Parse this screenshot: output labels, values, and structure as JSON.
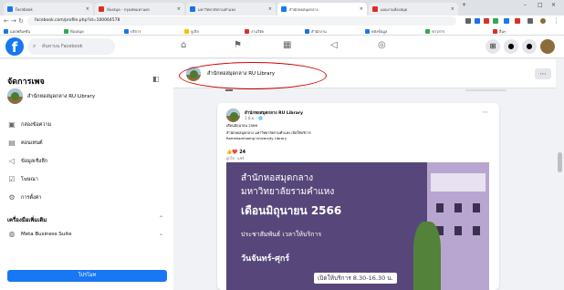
{
  "browser": {
    "tabs": [
      {
        "title": "Facebook",
        "active": false,
        "color": "#1877f2"
      },
      {
        "title": "ห้องสมุด - กรุงเทพมหานคร",
        "active": false,
        "color": "#d93025"
      },
      {
        "title": "มหาวิทยาลัยรามคำแหง",
        "active": false,
        "color": "#1a73e8"
      },
      {
        "title": "สำนักหอสมุดกลาง",
        "active": true,
        "color": "#1877f2"
      },
      {
        "title": "แผนงานห้องสมุด",
        "active": false,
        "color": "#d93025"
      }
    ],
    "url": "facebook.com/profile.php?id=100064578",
    "bookmarks": [
      {
        "label": "แอปพลิเคชัน",
        "color": "#1a73e8"
      },
      {
        "label": "ห้องสมุด",
        "color": "#34a853"
      },
      {
        "label": "บริการ",
        "color": "#1877f2"
      },
      {
        "label": "กูเกิล",
        "color": "#fbbc05"
      },
      {
        "label": "งานวิจัย",
        "color": "#d93025"
      },
      {
        "label": "สำนักงาน",
        "color": "#1a73e8"
      },
      {
        "label": "คลังข้อมูล",
        "color": "#1877f2"
      },
      {
        "label": "ข่าวสาร",
        "color": "#34a853"
      },
      {
        "label": "อื่นๆ",
        "color": "#d93025"
      }
    ]
  },
  "facebook": {
    "logo": "f",
    "search_placeholder": "ค้นหาบน Facebook",
    "nav_icons": [
      "home-icon",
      "flag-icon",
      "storefront-icon",
      "megaphone-icon",
      "groups-icon"
    ],
    "right_icons": [
      "grid-icon",
      "messenger-icon",
      "bell-icon",
      "profile-icon"
    ]
  },
  "sidebar": {
    "title": "จัดการเพจ",
    "page_name": "สำนักหอสมุดกลาง RU Library",
    "items": [
      {
        "icon": "inbox-icon",
        "label": "กล่องข้อความ"
      },
      {
        "icon": "content-icon",
        "label": "คอนเทนต์"
      },
      {
        "icon": "insights-icon",
        "label": "ข้อมูลเชิงลึก"
      },
      {
        "icon": "promote-icon",
        "label": "โฆษณา"
      },
      {
        "icon": "settings-icon",
        "label": "การตั้งค่า"
      }
    ],
    "section_title": "เครื่องมือเพิ่มเติม",
    "mbs_label": "Meta Business Suite",
    "promote_button": "โปรโมท"
  },
  "page_header": {
    "name": "สำนักหอสมุดกลาง RU Library",
    "more": "⋯"
  },
  "post": {
    "author": "สำนักหอสมุดกลาง RU Library",
    "time": "1 มิ.ย. · 🌐",
    "line1": "เดือนมิถุนายน 2566",
    "line2": "สำนักหอสมุดกลาง มหาวิทยาลัยรามคำแหง เปิดให้บริการ",
    "line3": "Ramkhamhaeng University Library",
    "reacts": "👍❤️ 24",
    "reacts_sub": "ถูกใจ · แชร์",
    "image": {
      "line1": "สำนักหอสมุดกลาง",
      "line2": "มหาวิทยาลัยรามคำแหง",
      "line3": "เดือนมิถุนายน 2566",
      "line4": "ประชาสัมพันธ์ เวลาให้บริการ",
      "line5": "วันจันทร์-ศุกร์",
      "badge": "เปิดให้บริการ 8.30-16.30 น."
    }
  },
  "colors": {
    "brand": "#1877f2",
    "highlight": "#d00000"
  }
}
